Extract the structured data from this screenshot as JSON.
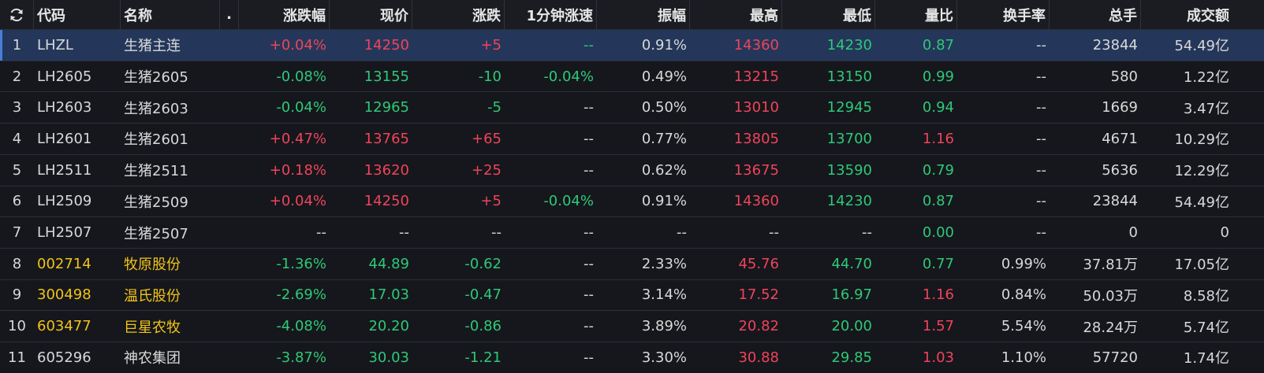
{
  "header": {
    "code": "代码",
    "name": "名称",
    "flag": ".",
    "change_pct": "涨跌幅",
    "price": "现价",
    "change": "涨跌",
    "speed_1min": "1分钟涨速",
    "amplitude": "振幅",
    "high": "最高",
    "low": "最低",
    "volume_ratio": "量比",
    "turnover_rate": "换手率",
    "total_volume": "总手",
    "turnover": "成交额"
  },
  "colors": {
    "up": "#f0435b",
    "down": "#2fc878",
    "flat": "#d8d8d8",
    "stock_code": "#f2c21a",
    "selected_row": "#24375a",
    "background": "#15171c"
  },
  "rows": [
    {
      "index": "1",
      "code": "LHZL",
      "name": "生猪主连",
      "change_pct": "+0.04%",
      "price": "14250",
      "change": "+5",
      "speed": "--",
      "amplitude": "0.91%",
      "high": "14360",
      "low": "14230",
      "volume_ratio": "0.87",
      "turnover_rate": "--",
      "total_volume": "23844",
      "turnover": "54.49亿"
    },
    {
      "index": "2",
      "code": "LH2605",
      "name": "生猪2605",
      "change_pct": "-0.08%",
      "price": "13155",
      "change": "-10",
      "speed": "-0.04%",
      "amplitude": "0.49%",
      "high": "13215",
      "low": "13150",
      "volume_ratio": "0.99",
      "turnover_rate": "--",
      "total_volume": "580",
      "turnover": "1.22亿"
    },
    {
      "index": "3",
      "code": "LH2603",
      "name": "生猪2603",
      "change_pct": "-0.04%",
      "price": "12965",
      "change": "-5",
      "speed": "--",
      "amplitude": "0.50%",
      "high": "13010",
      "low": "12945",
      "volume_ratio": "0.94",
      "turnover_rate": "--",
      "total_volume": "1669",
      "turnover": "3.47亿"
    },
    {
      "index": "4",
      "code": "LH2601",
      "name": "生猪2601",
      "change_pct": "+0.47%",
      "price": "13765",
      "change": "+65",
      "speed": "--",
      "amplitude": "0.77%",
      "high": "13805",
      "low": "13700",
      "volume_ratio": "1.16",
      "turnover_rate": "--",
      "total_volume": "4671",
      "turnover": "10.29亿"
    },
    {
      "index": "5",
      "code": "LH2511",
      "name": "生猪2511",
      "change_pct": "+0.18%",
      "price": "13620",
      "change": "+25",
      "speed": "--",
      "amplitude": "0.62%",
      "high": "13675",
      "low": "13590",
      "volume_ratio": "0.79",
      "turnover_rate": "--",
      "total_volume": "5636",
      "turnover": "12.29亿"
    },
    {
      "index": "6",
      "code": "LH2509",
      "name": "生猪2509",
      "change_pct": "+0.04%",
      "price": "14250",
      "change": "+5",
      "speed": "-0.04%",
      "amplitude": "0.91%",
      "high": "14360",
      "low": "14230",
      "volume_ratio": "0.87",
      "turnover_rate": "--",
      "total_volume": "23844",
      "turnover": "54.49亿"
    },
    {
      "index": "7",
      "code": "LH2507",
      "name": "生猪2507",
      "change_pct": "--",
      "price": "--",
      "change": "--",
      "speed": "--",
      "amplitude": "--",
      "high": "--",
      "low": "--",
      "volume_ratio": "0.00",
      "turnover_rate": "--",
      "total_volume": "0",
      "turnover": "0"
    },
    {
      "index": "8",
      "code": "002714",
      "name": "牧原股份",
      "change_pct": "-1.36%",
      "price": "44.89",
      "change": "-0.62",
      "speed": "--",
      "amplitude": "2.33%",
      "high": "45.76",
      "low": "44.70",
      "volume_ratio": "0.77",
      "turnover_rate": "0.99%",
      "total_volume": "37.81万",
      "turnover": "17.05亿"
    },
    {
      "index": "9",
      "code": "300498",
      "name": "温氏股份",
      "change_pct": "-2.69%",
      "price": "17.03",
      "change": "-0.47",
      "speed": "--",
      "amplitude": "3.14%",
      "high": "17.52",
      "low": "16.97",
      "volume_ratio": "1.16",
      "turnover_rate": "0.84%",
      "total_volume": "50.03万",
      "turnover": "8.58亿"
    },
    {
      "index": "10",
      "code": "603477",
      "name": "巨星农牧",
      "change_pct": "-4.08%",
      "price": "20.20",
      "change": "-0.86",
      "speed": "--",
      "amplitude": "3.89%",
      "high": "20.82",
      "low": "20.00",
      "volume_ratio": "1.57",
      "turnover_rate": "5.54%",
      "total_volume": "28.24万",
      "turnover": "5.74亿"
    },
    {
      "index": "11",
      "code": "605296",
      "name": "神农集团",
      "change_pct": "-3.87%",
      "price": "30.03",
      "change": "-1.21",
      "speed": "--",
      "amplitude": "3.30%",
      "high": "30.88",
      "low": "29.85",
      "volume_ratio": "1.03",
      "turnover_rate": "1.10%",
      "total_volume": "57720",
      "turnover": "1.74亿"
    }
  ]
}
